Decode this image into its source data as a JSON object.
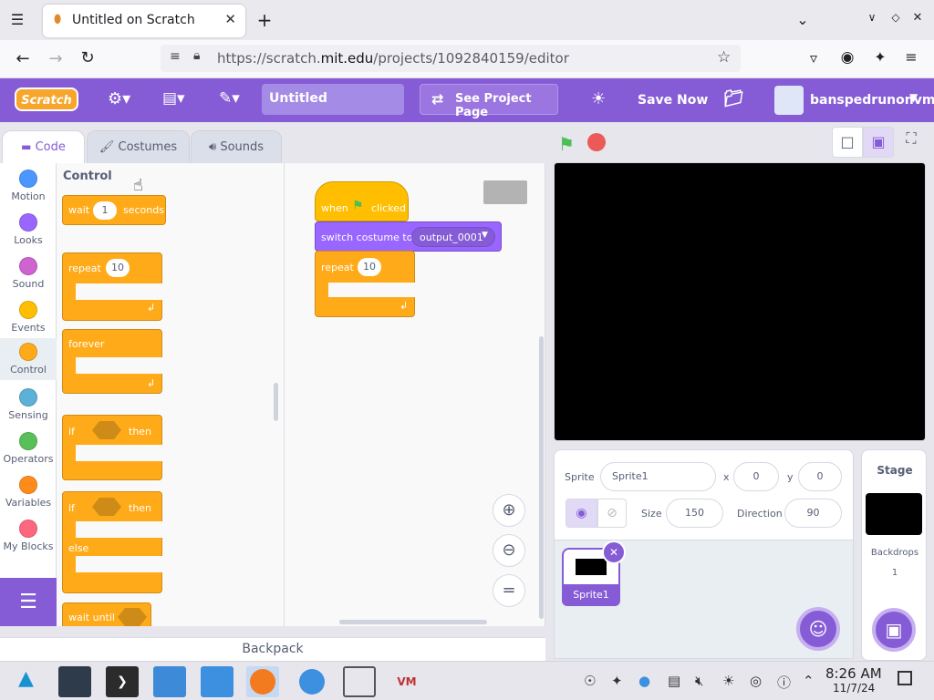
{
  "browser": {
    "tab_title": "Untitled on Scratch",
    "url_prefix": "https://scratch.",
    "url_domain": "mit.edu",
    "url_path": "/projects/1092840159/editor"
  },
  "menubar": {
    "logo": "Scratch",
    "project_title": "Untitled",
    "see_project_page": "See Project Page",
    "save_now": "Save Now",
    "username": "banspedrunonvm"
  },
  "editor_tabs": [
    "Code",
    "Costumes",
    "Sounds"
  ],
  "categories": [
    {
      "label": "Motion",
      "color": "#4c97ff"
    },
    {
      "label": "Looks",
      "color": "#9966ff"
    },
    {
      "label": "Sound",
      "color": "#cf63cf"
    },
    {
      "label": "Events",
      "color": "#ffbf00"
    },
    {
      "label": "Control",
      "color": "#ffab19"
    },
    {
      "label": "Sensing",
      "color": "#5cb1d6"
    },
    {
      "label": "Operators",
      "color": "#59c059"
    },
    {
      "label": "Variables",
      "color": "#ff8c1a"
    },
    {
      "label": "My Blocks",
      "color": "#ff6680"
    }
  ],
  "palette": {
    "heading": "Control",
    "wait_label": "wait",
    "wait_value": "1",
    "wait_unit": "seconds",
    "repeat_label": "repeat",
    "repeat_value": "10",
    "forever_label": "forever",
    "if_label": "if",
    "then_label": "then",
    "else_label": "else",
    "wait_until_label": "wait until"
  },
  "script": {
    "when_label": "when",
    "clicked_label": "clicked",
    "switch_costume_label": "switch costume to",
    "costume_value": "output_0001",
    "repeat_label": "repeat",
    "repeat_value": "10"
  },
  "backpack": "Backpack",
  "sprite_info": {
    "sprite_label": "Sprite",
    "sprite_name": "Sprite1",
    "x_label": "x",
    "x_value": "0",
    "y_label": "y",
    "y_value": "0",
    "size_label": "Size",
    "size_value": "150",
    "direction_label": "Direction",
    "direction_value": "90"
  },
  "sprite_thumb_name": "Sprite1",
  "stage_pane": {
    "title": "Stage",
    "backdrops_label": "Backdrops",
    "backdrops_count": "1"
  },
  "taskbar": {
    "time": "8:26 AM",
    "date": "11/7/24"
  },
  "colors": {
    "scratch_purple": "#855cd6",
    "control_orange": "#ffab19",
    "events_yellow": "#ffbf00"
  }
}
